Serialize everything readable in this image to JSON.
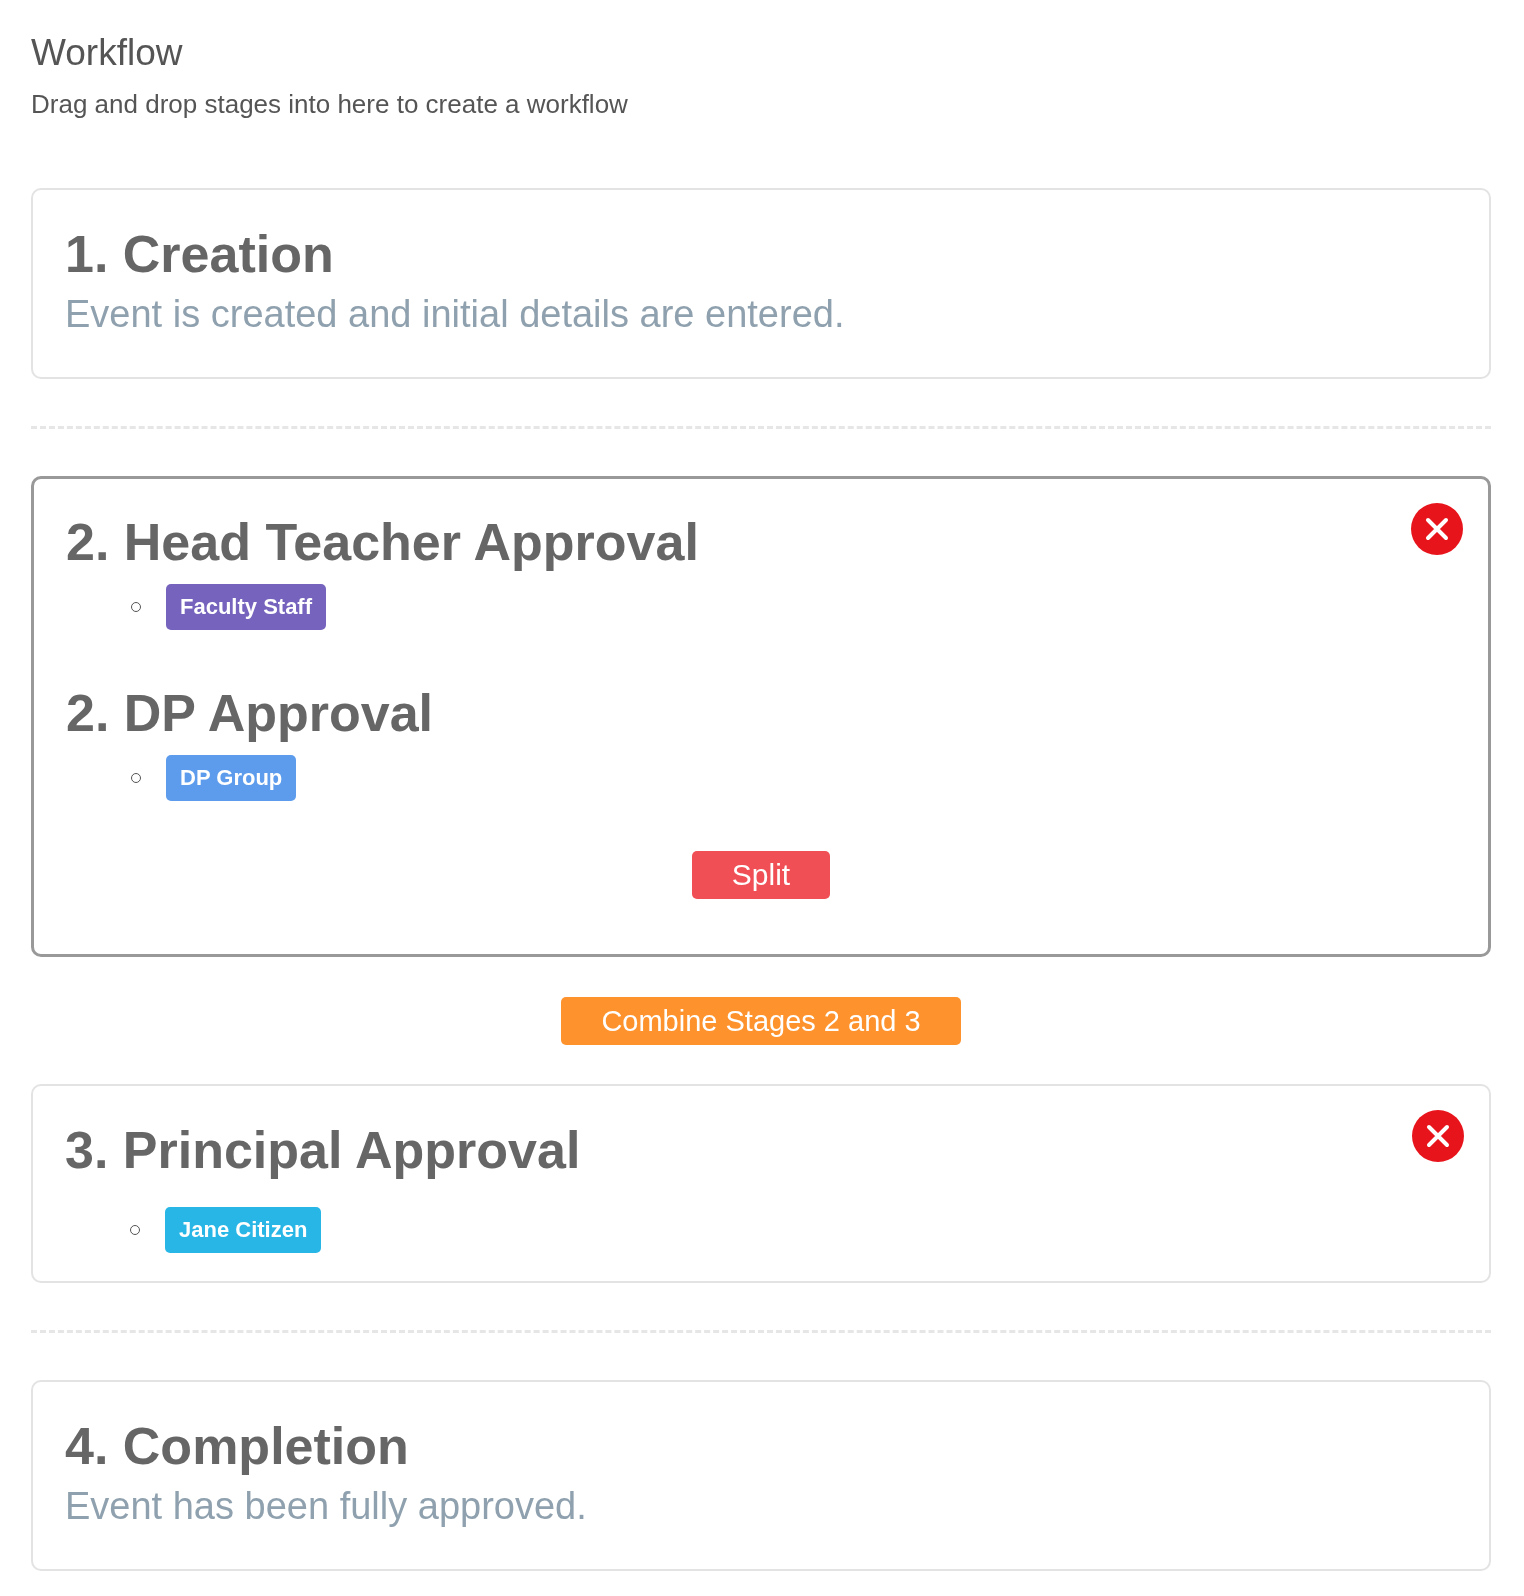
{
  "header": {
    "title": "Workflow",
    "subtitle": "Drag and drop stages into here to create a workflow"
  },
  "items": [
    {
      "kind": "stage",
      "removable": false,
      "steps": [
        {
          "title": "1. Creation",
          "description": "Event is created and initial details are entered."
        }
      ]
    },
    {
      "kind": "divider"
    },
    {
      "kind": "group",
      "removable": true,
      "steps": [
        {
          "title": "2. Head Teacher Approval",
          "assignees": [
            {
              "label": "Faculty Staff",
              "color": "#7563bd"
            }
          ]
        },
        {
          "title": "2. DP Approval",
          "assignees": [
            {
              "label": "DP Group",
              "color": "#5d9cec"
            }
          ]
        }
      ],
      "split_button": "Split"
    },
    {
      "kind": "action",
      "label": "Combine Stages 2 and 3"
    },
    {
      "kind": "stage",
      "removable": true,
      "steps": [
        {
          "title": "3. Principal Approval",
          "assignees": [
            {
              "label": "Jane Citizen",
              "color": "#27b6e6"
            }
          ]
        }
      ]
    },
    {
      "kind": "divider"
    },
    {
      "kind": "stage",
      "removable": false,
      "steps": [
        {
          "title": "4. Completion",
          "description": "Event has been fully approved."
        }
      ]
    }
  ]
}
